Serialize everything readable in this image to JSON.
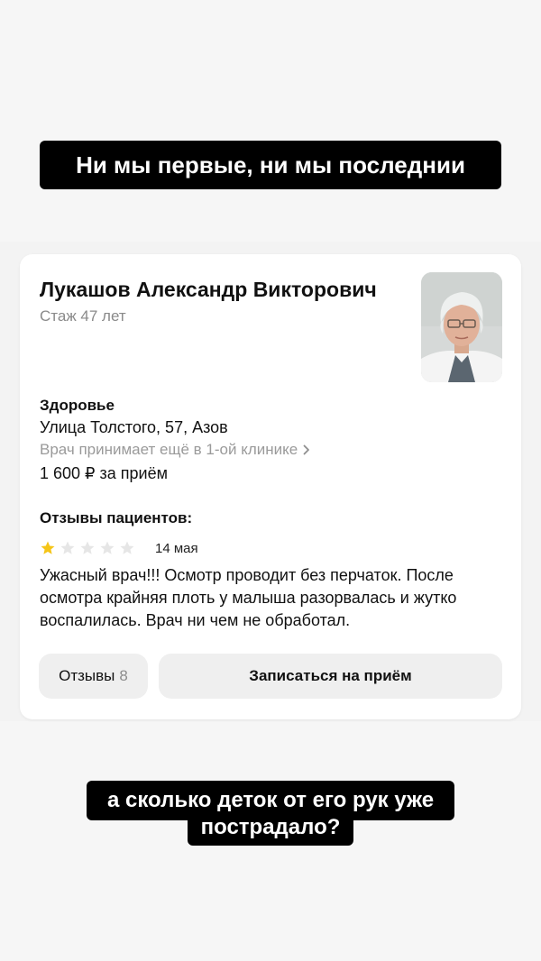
{
  "captions": {
    "top": "Ни мы первые, ни мы последнии",
    "bottom_line1": "а сколько деток от его рук уже",
    "bottom_line2": "пострадало?"
  },
  "doctor": {
    "name": "Лукашов Александр Викторович",
    "experience": "Стаж 47 лет",
    "photo_icon": "doctor-portrait"
  },
  "clinic": {
    "name": "Здоровье",
    "address": "Улица Толстого, 57, Азов",
    "other_clinics": "Врач принимает ещё в 1-ой клинике",
    "price": "1 600 ₽ за приём"
  },
  "reviews": {
    "title": "Отзывы пациентов:",
    "rating": 1,
    "max_rating": 5,
    "star_color": "#f5c518",
    "star_empty_color": "#e6e6e6",
    "date": "14 мая",
    "text": "Ужасный врач!!! Осмотр проводит без перчаток. После осмотра крайняя плоть у малыша разорвалась и жутко воспалилась. Врач ни чем не обработал."
  },
  "actions": {
    "reviews_label": "Отзывы",
    "reviews_count": "8",
    "book_label": "Записаться на приём"
  }
}
